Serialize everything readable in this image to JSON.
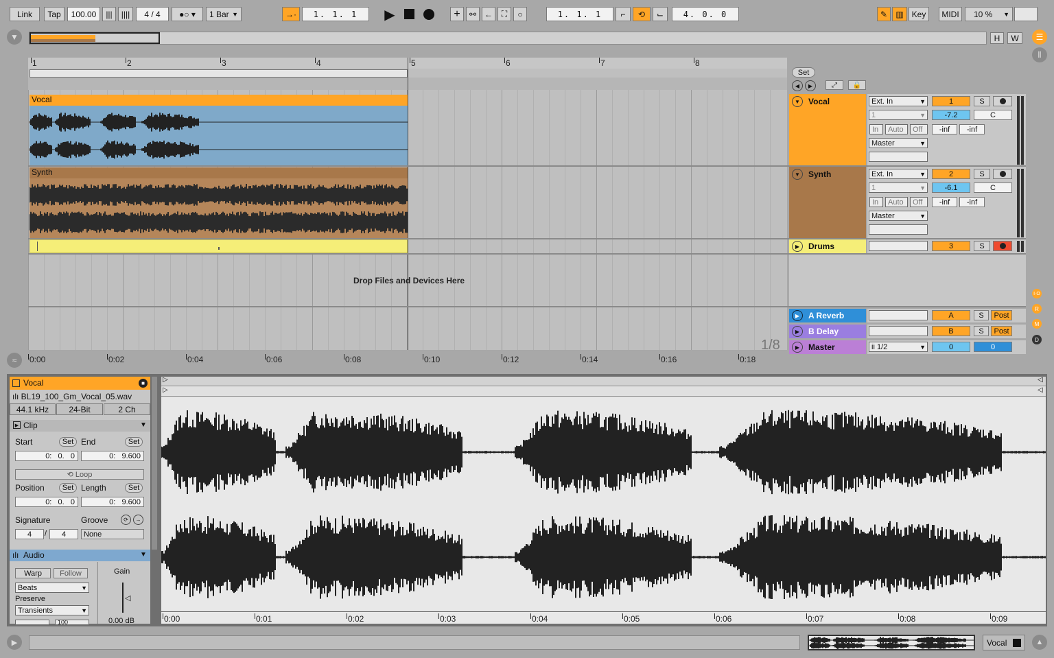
{
  "control_bar": {
    "link": "Link",
    "tap": "Tap",
    "tempo": "100.00",
    "signature": "4 / 4",
    "quantize": "1 Bar",
    "song_position": "1.   1.   1",
    "loop_start": "1.   1.   1",
    "loop_length": "4.   0.   0",
    "key": "Key",
    "midi": "MIDI",
    "cpu": "10 %"
  },
  "overview": {
    "h_label": "H",
    "w_label": "W"
  },
  "arrangement": {
    "bars": [
      "1",
      "2",
      "3",
      "4",
      "5",
      "6",
      "7",
      "8"
    ],
    "time_ticks": [
      "0:00",
      "0:02",
      "0:04",
      "0:06",
      "0:08",
      "0:10",
      "0:12",
      "0:14",
      "0:16",
      "0:18"
    ],
    "drop_text": "Drop Files and Devices Here",
    "zoom_label": "1/8",
    "set_label": "Set",
    "tracks": [
      {
        "name": "Vocal",
        "clip_label": "Vocal",
        "color": "#ffa526",
        "input": "Ext. In",
        "channel": "1",
        "monitor": [
          "In",
          "Auto",
          "Off"
        ],
        "output": "Master",
        "number": "1",
        "solo": "S",
        "volume": "-7.2",
        "pan": "C",
        "peak_l": "-inf",
        "peak_r": "-inf"
      },
      {
        "name": "Synth",
        "clip_label": "Synth",
        "color": "#a8784a",
        "input": "Ext. In",
        "channel": "1",
        "monitor": [
          "In",
          "Auto",
          "Off"
        ],
        "output": "Master",
        "number": "2",
        "solo": "S",
        "volume": "-6.1",
        "pan": "C",
        "peak_l": "-inf",
        "peak_r": "-inf"
      },
      {
        "name": "Drums",
        "color": "#f5ee78",
        "number": "3",
        "solo": "S"
      }
    ],
    "returns": [
      {
        "name": "A Reverb",
        "letter": "A",
        "solo": "S",
        "post": "Post",
        "color": "#2f8fd8"
      },
      {
        "name": "B Delay",
        "letter": "B",
        "solo": "S",
        "post": "Post",
        "color": "#9a7ee0"
      }
    ],
    "master": {
      "name": "Master",
      "cue_out": "ii 1/2",
      "val_a": "0",
      "val_b": "0",
      "color": "#bb7fd6"
    },
    "side_io": [
      "I·O",
      "R",
      "M",
      "D"
    ]
  },
  "clip_view": {
    "track_name": "Vocal",
    "file_name": "BL19_100_Gm_Vocal_05.wav",
    "sample_rate": "44.1 kHz",
    "bit_depth": "24-Bit",
    "channels": "2 Ch",
    "clip_section": "Clip",
    "start_label": "Start",
    "end_label": "End",
    "set": "Set",
    "start_value": "0:   0.   0",
    "end_value": "0:   9.600",
    "loop_label": "Loop",
    "position_label": "Position",
    "length_label": "Length",
    "position_value": "0:   0.   0",
    "length_value": "0:   9.600",
    "signature_label": "Signature",
    "groove_label": "Groove",
    "sig_num": "4",
    "sig_den": "4",
    "groove_value": "None",
    "audio_section": "Audio",
    "warp": "Warp",
    "follow": "Follow",
    "warp_mode": "Beats",
    "preserve_label": "Preserve",
    "preserve_value": "Transients",
    "gain_label": "Gain",
    "gain_value": "0.00 dB",
    "bottom_value": "100",
    "time_ticks": [
      "0:00",
      "0:01",
      "0:02",
      "0:03",
      "0:04",
      "0:05",
      "0:06",
      "0:07",
      "0:08",
      "0:09"
    ]
  },
  "status_bar": {
    "selected_track": "Vocal"
  }
}
